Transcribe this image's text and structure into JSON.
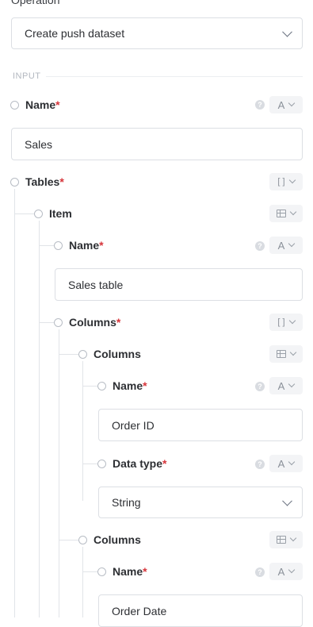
{
  "operation": {
    "label": "Operation",
    "value": "Create push dataset"
  },
  "section_title": "INPUT",
  "fields": {
    "name": {
      "label": "Name",
      "required": "*",
      "type_badge": "A",
      "value": "Sales"
    },
    "tables": {
      "label": "Tables",
      "required": "*",
      "type_badge": "[ ]"
    },
    "item": {
      "label": "Item"
    },
    "table_name": {
      "label": "Name",
      "required": "*",
      "type_badge": "A",
      "value": "Sales table"
    },
    "columns": {
      "label": "Columns",
      "required": "*",
      "type_badge": "[ ]"
    },
    "column_1": {
      "label": "Columns",
      "name": {
        "label": "Name",
        "required": "*",
        "type_badge": "A",
        "value": "Order ID"
      },
      "data_type": {
        "label": "Data type",
        "required": "*",
        "type_badge": "A",
        "value": "String"
      }
    },
    "column_2": {
      "label": "Columns",
      "name": {
        "label": "Name",
        "required": "*",
        "type_badge": "A",
        "value": "Order Date"
      }
    }
  },
  "help_glyph": "?",
  "icons": [
    "chevron-down-icon",
    "help-icon",
    "table-icon",
    "radio-icon"
  ]
}
